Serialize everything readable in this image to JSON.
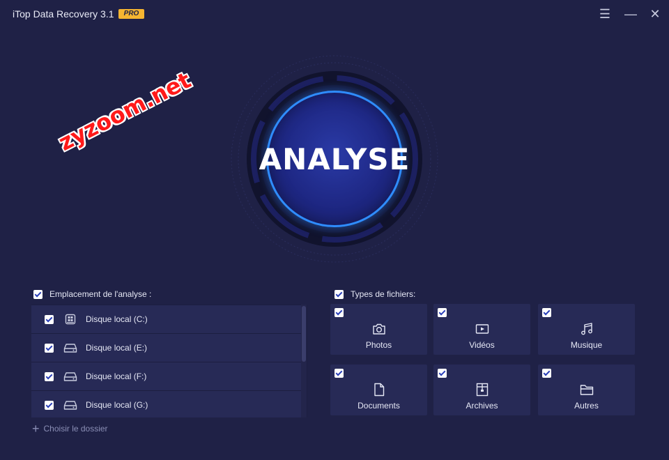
{
  "window": {
    "title": "iTop Data Recovery 3.1",
    "badge": "PRO",
    "menu_glyph": "☰",
    "minimize_glyph": "—",
    "close_glyph": "✕"
  },
  "main_action": {
    "label": "ANALYSE"
  },
  "watermark": "zyzoom.net",
  "location": {
    "header": "Emplacement de l'analyse :",
    "checked": true,
    "drives": [
      {
        "label": "Disque local (C:)",
        "icon": "windows-drive-icon",
        "checked": true
      },
      {
        "label": "Disque local (E:)",
        "icon": "hard-drive-icon",
        "checked": true
      },
      {
        "label": "Disque local (F:)",
        "icon": "hard-drive-icon",
        "checked": true
      },
      {
        "label": "Disque local (G:)",
        "icon": "hard-drive-icon",
        "checked": true
      }
    ],
    "choose_folder_icon": "+",
    "choose_folder": "Choisir le dossier"
  },
  "file_types": {
    "header": "Types de fichiers:",
    "checked": true,
    "tiles": [
      {
        "label": "Photos",
        "icon": "camera-icon",
        "checked": true
      },
      {
        "label": "Vidéos",
        "icon": "video-icon",
        "checked": true
      },
      {
        "label": "Musique",
        "icon": "music-icon",
        "checked": true
      },
      {
        "label": "Documents",
        "icon": "document-icon",
        "checked": true
      },
      {
        "label": "Archives",
        "icon": "archive-icon",
        "checked": true
      },
      {
        "label": "Autres",
        "icon": "folder-icon",
        "checked": true
      }
    ]
  },
  "colors": {
    "background": "#1f2146",
    "panel": "#272a56",
    "accent": "#2f8dff",
    "badge": "#f5b531"
  }
}
